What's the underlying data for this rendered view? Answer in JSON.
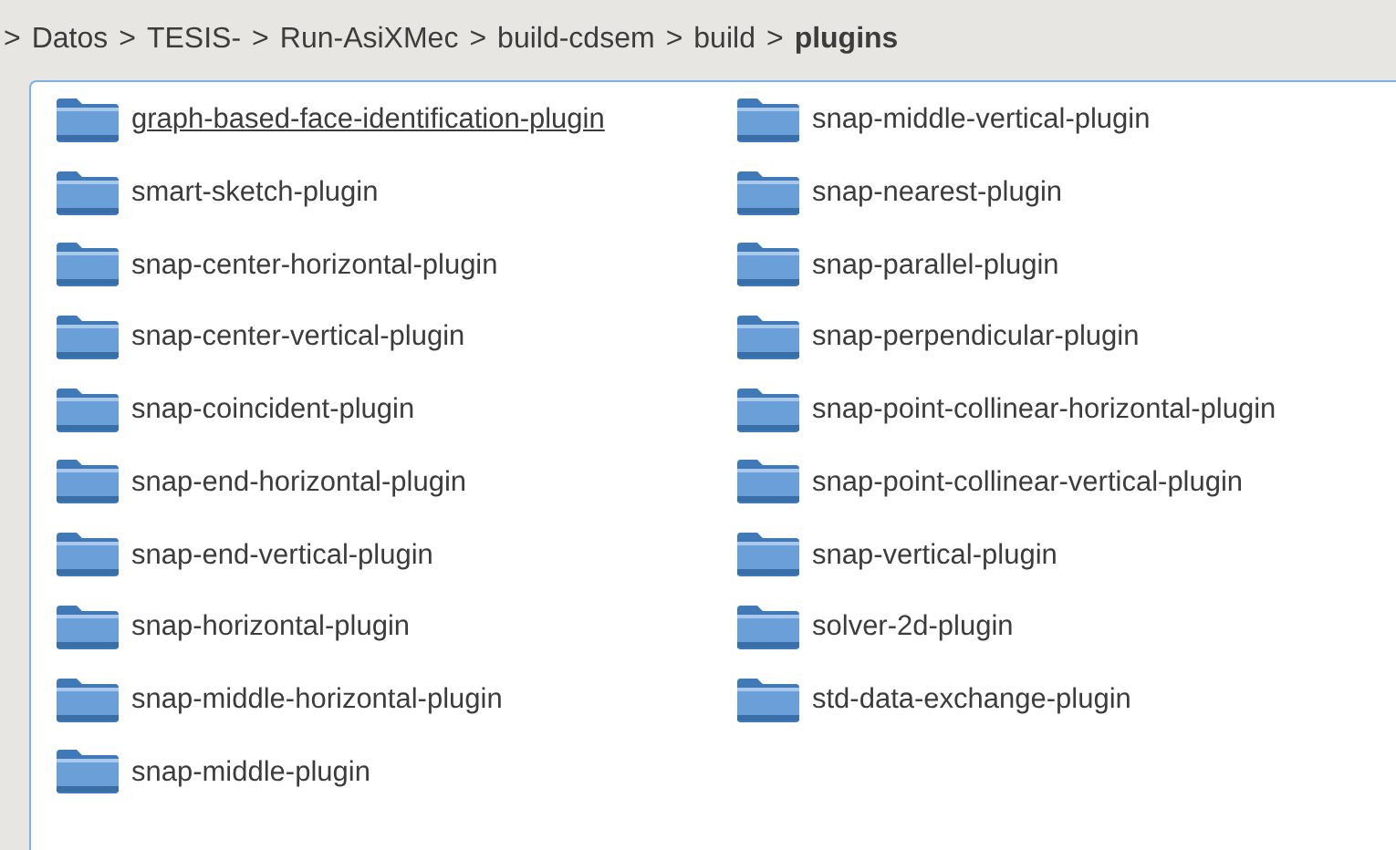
{
  "breadcrumb": [
    {
      "separator": ">",
      "label": "Datos",
      "current": false
    },
    {
      "separator": ">",
      "label": "TESIS-",
      "current": false
    },
    {
      "separator": ">",
      "label": "Run-AsiXMec",
      "current": false
    },
    {
      "separator": ">",
      "label": "build-cdsem",
      "current": false
    },
    {
      "separator": ">",
      "label": "build",
      "current": false
    },
    {
      "separator": ">",
      "label": "plugins",
      "current": true
    }
  ],
  "folders": [
    {
      "name": "graph-based-face-identification-plugin",
      "hovered": true
    },
    {
      "name": "smart-sketch-plugin",
      "hovered": false
    },
    {
      "name": "snap-center-horizontal-plugin",
      "hovered": false
    },
    {
      "name": "snap-center-vertical-plugin",
      "hovered": false
    },
    {
      "name": "snap-coincident-plugin",
      "hovered": false
    },
    {
      "name": "snap-end-horizontal-plugin",
      "hovered": false
    },
    {
      "name": "snap-end-vertical-plugin",
      "hovered": false
    },
    {
      "name": "snap-horizontal-plugin",
      "hovered": false
    },
    {
      "name": "snap-middle-horizontal-plugin",
      "hovered": false
    },
    {
      "name": "snap-middle-plugin",
      "hovered": false
    },
    {
      "name": "snap-middle-vertical-plugin",
      "hovered": false
    },
    {
      "name": "snap-nearest-plugin",
      "hovered": false
    },
    {
      "name": "snap-parallel-plugin",
      "hovered": false
    },
    {
      "name": "snap-perpendicular-plugin",
      "hovered": false
    },
    {
      "name": "snap-point-collinear-horizontal-plugin",
      "hovered": false
    },
    {
      "name": "snap-point-collinear-vertical-plugin",
      "hovered": false
    },
    {
      "name": "snap-vertical-plugin",
      "hovered": false
    },
    {
      "name": "solver-2d-plugin",
      "hovered": false
    },
    {
      "name": "std-data-exchange-plugin",
      "hovered": false
    }
  ]
}
